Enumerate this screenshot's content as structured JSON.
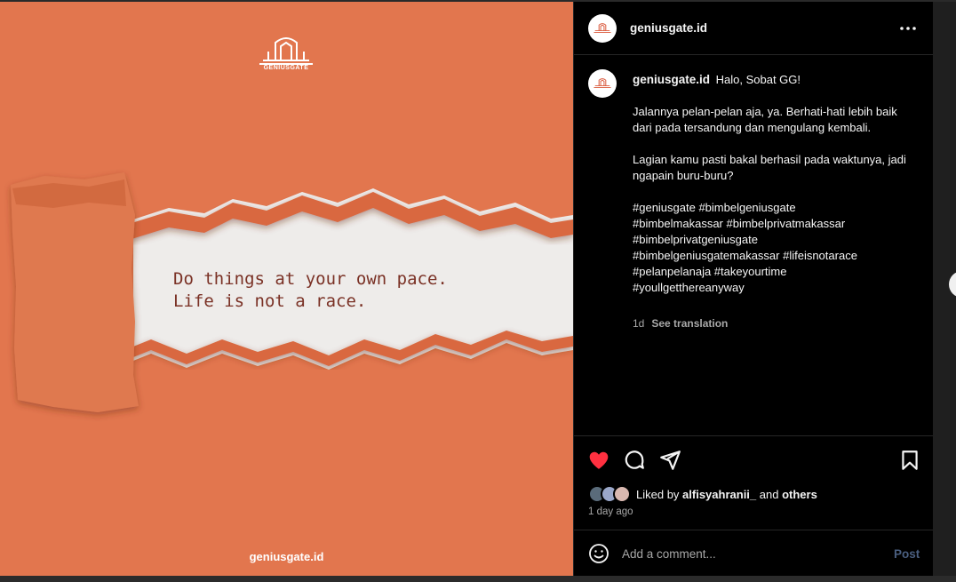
{
  "post": {
    "image_alt": "Do things at your own pace. Life is not a race.",
    "brand_logo_text": "GENIUSGATE",
    "quote_line1": "Do things at your own pace.",
    "quote_line2": "Life is not a race.",
    "image_footer": "geniusgate.id"
  },
  "header": {
    "username": "geniusgate.id",
    "more_icon": "more-horizontal-icon"
  },
  "caption": {
    "username": "geniusgate.id",
    "greeting": "Halo, Sobat GG!",
    "paragraph1": "Jalannya pelan-pelan aja, ya. Berhati-hati lebih baik dari pada tersandung dan mengulang kembali.",
    "paragraph2": "Lagian kamu pasti bakal berhasil pada waktunya, jadi ngapain buru-buru?",
    "hashtag_lines": [
      "#geniusgate #bimbelgeniusgate",
      "#bimbelmakassar #bimbelprivatmakassar",
      "#bimbelprivatgeniusgate",
      "#bimbelgeniusgatemakassar #lifeisnotarace",
      "#pelanpelanaja #takeyourtime",
      "#youllgetthereanyway"
    ],
    "age": "1d",
    "see_translation": "See translation"
  },
  "actions": {
    "like_icon": "heart-filled-icon",
    "comment_icon": "comment-icon",
    "share_icon": "send-icon",
    "save_icon": "bookmark-icon",
    "like_color": "#ff3040"
  },
  "likes": {
    "prefix": "Liked by ",
    "user": "alfisyahranii_",
    "middle": " and ",
    "others": "others"
  },
  "timestamp": "1 day ago",
  "comment": {
    "emoji_icon": "emoji-icon",
    "placeholder": "Add a comment...",
    "post_label": "Post"
  },
  "colors": {
    "image_bg": "#e2764e",
    "quote_text": "#7a3125",
    "panel_bg": "#000000",
    "post_button": "#4a5f80"
  }
}
